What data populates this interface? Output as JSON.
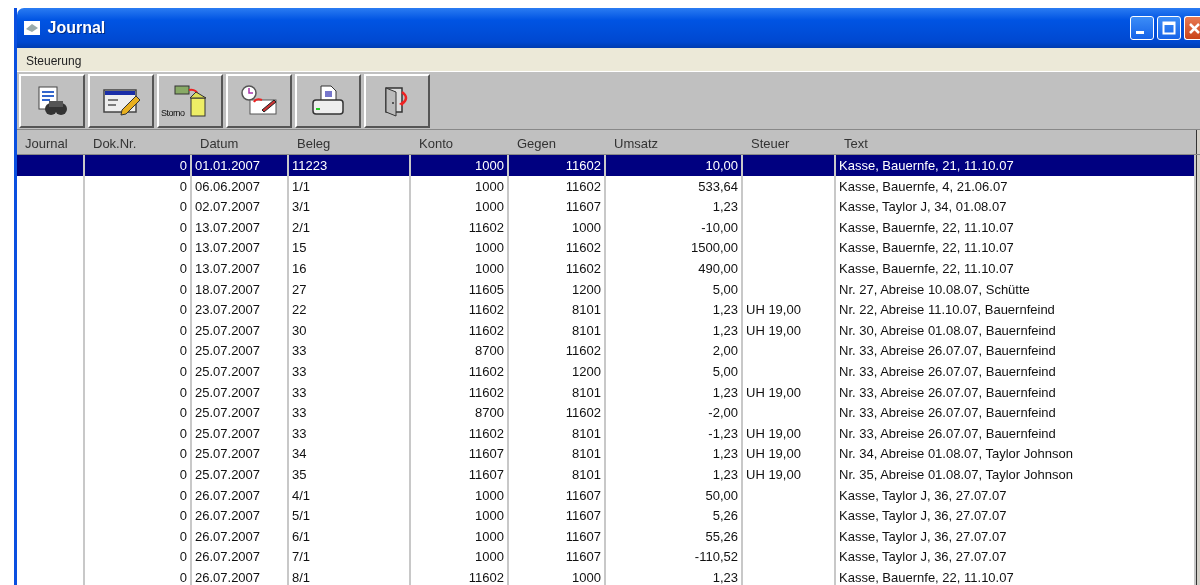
{
  "window": {
    "title": "Journal"
  },
  "menu": [
    {
      "label": "Steuerung"
    }
  ],
  "toolbar": [
    {
      "kind": "report"
    },
    {
      "kind": "edit"
    },
    {
      "kind": "storno",
      "label": "Storno"
    },
    {
      "kind": "schedule"
    },
    {
      "kind": "print"
    },
    {
      "kind": "exit"
    }
  ],
  "table": {
    "columns": [
      "Journal",
      "Dok.Nr.",
      "Datum",
      "Beleg",
      "Konto",
      "Gegen",
      "Umsatz",
      "Steuer",
      "Text"
    ],
    "rows": [
      {
        "selected": true,
        "dok_nr": "0",
        "datum": "01.01.2007",
        "beleg": "11223",
        "konto": "1000",
        "gegen": "11602",
        "umsatz": "10,00",
        "text": "Kasse, Bauernfe, 21, 11.10.07"
      },
      {
        "selected": false,
        "dok_nr": "0",
        "datum": "06.06.2007",
        "beleg": "1/1",
        "konto": "1000",
        "gegen": "11602",
        "umsatz": "533,64",
        "text": "Kasse, Bauernfe, 4, 21.06.07"
      },
      {
        "selected": false,
        "dok_nr": "0",
        "datum": "02.07.2007",
        "beleg": "3/1",
        "konto": "1000",
        "gegen": "11607",
        "umsatz": "1,23",
        "text": "Kasse, Taylor J, 34, 01.08.07"
      },
      {
        "selected": false,
        "dok_nr": "0",
        "datum": "13.07.2007",
        "beleg": "2/1",
        "konto": "11602",
        "gegen": "1000",
        "umsatz": "-10,00",
        "text": "Kasse, Bauernfe, 22, 11.10.07"
      },
      {
        "selected": false,
        "dok_nr": "0",
        "datum": "13.07.2007",
        "beleg": "15",
        "konto": "1000",
        "gegen": "11602",
        "umsatz": "1500,00",
        "text": "Kasse, Bauernfe, 22, 11.10.07"
      },
      {
        "selected": false,
        "dok_nr": "0",
        "datum": "13.07.2007",
        "beleg": "16",
        "konto": "1000",
        "gegen": "11602",
        "umsatz": "490,00",
        "text": "Kasse, Bauernfe, 22, 11.10.07"
      },
      {
        "selected": false,
        "dok_nr": "0",
        "datum": "18.07.2007",
        "beleg": "27",
        "konto": "11605",
        "gegen": "1200",
        "umsatz": "5,00",
        "text": "Nr. 27, Abreise 10.08.07, Schütte"
      },
      {
        "selected": false,
        "dok_nr": "0",
        "datum": "23.07.2007",
        "beleg": "22",
        "konto": "11602",
        "gegen": "8101",
        "umsatz": "1,23",
        "steuer": "UH 19,00",
        "text": "Nr. 22, Abreise 11.10.07, Bauernfeind"
      },
      {
        "selected": false,
        "dok_nr": "0",
        "datum": "25.07.2007",
        "beleg": "30",
        "konto": "11602",
        "gegen": "8101",
        "umsatz": "1,23",
        "steuer": "UH 19,00",
        "text": "Nr. 30, Abreise 01.08.07, Bauernfeind"
      },
      {
        "selected": false,
        "dok_nr": "0",
        "datum": "25.07.2007",
        "beleg": "33",
        "konto": "8700",
        "gegen": "11602",
        "umsatz": "2,00",
        "text": "Nr. 33, Abreise 26.07.07, Bauernfeind"
      },
      {
        "selected": false,
        "dok_nr": "0",
        "datum": "25.07.2007",
        "beleg": "33",
        "konto": "11602",
        "gegen": "1200",
        "umsatz": "5,00",
        "text": "Nr. 33, Abreise 26.07.07, Bauernfeind"
      },
      {
        "selected": false,
        "dok_nr": "0",
        "datum": "25.07.2007",
        "beleg": "33",
        "konto": "11602",
        "gegen": "8101",
        "umsatz": "1,23",
        "steuer": "UH 19,00",
        "text": "Nr. 33, Abreise 26.07.07, Bauernfeind"
      },
      {
        "selected": false,
        "dok_nr": "0",
        "datum": "25.07.2007",
        "beleg": "33",
        "konto": "8700",
        "gegen": "11602",
        "umsatz": "-2,00",
        "text": "Nr. 33, Abreise 26.07.07, Bauernfeind"
      },
      {
        "selected": false,
        "dok_nr": "0",
        "datum": "25.07.2007",
        "beleg": "33",
        "konto": "11602",
        "gegen": "8101",
        "umsatz": "-1,23",
        "steuer": "UH 19,00",
        "text": "Nr. 33, Abreise 26.07.07, Bauernfeind"
      },
      {
        "selected": false,
        "dok_nr": "0",
        "datum": "25.07.2007",
        "beleg": "34",
        "konto": "11607",
        "gegen": "8101",
        "umsatz": "1,23",
        "steuer": "UH 19,00",
        "text": "Nr. 34, Abreise 01.08.07, Taylor Johnson"
      },
      {
        "selected": false,
        "dok_nr": "0",
        "datum": "25.07.2007",
        "beleg": "35",
        "konto": "11607",
        "gegen": "8101",
        "umsatz": "1,23",
        "steuer": "UH 19,00",
        "text": "Nr. 35, Abreise 01.08.07, Taylor Johnson"
      },
      {
        "selected": false,
        "dok_nr": "0",
        "datum": "26.07.2007",
        "beleg": "4/1",
        "konto": "1000",
        "gegen": "11607",
        "umsatz": "50,00",
        "text": "Kasse, Taylor J, 36, 27.07.07"
      },
      {
        "selected": false,
        "dok_nr": "0",
        "datum": "26.07.2007",
        "beleg": "5/1",
        "konto": "1000",
        "gegen": "11607",
        "umsatz": "5,26",
        "text": "Kasse, Taylor J, 36, 27.07.07"
      },
      {
        "selected": false,
        "dok_nr": "0",
        "datum": "26.07.2007",
        "beleg": "6/1",
        "konto": "1000",
        "gegen": "11607",
        "umsatz": "55,26",
        "text": "Kasse, Taylor J, 36, 27.07.07"
      },
      {
        "selected": false,
        "dok_nr": "0",
        "datum": "26.07.2007",
        "beleg": "7/1",
        "konto": "1000",
        "gegen": "11607",
        "umsatz": "-110,52",
        "text": "Kasse, Taylor J, 36, 27.07.07"
      },
      {
        "selected": false,
        "dok_nr": "0",
        "datum": "26.07.2007",
        "beleg": "8/1",
        "konto": "11602",
        "gegen": "1000",
        "umsatz": "1,23",
        "text": "Kasse, Bauernfe, 22, 11.10.07"
      }
    ]
  }
}
